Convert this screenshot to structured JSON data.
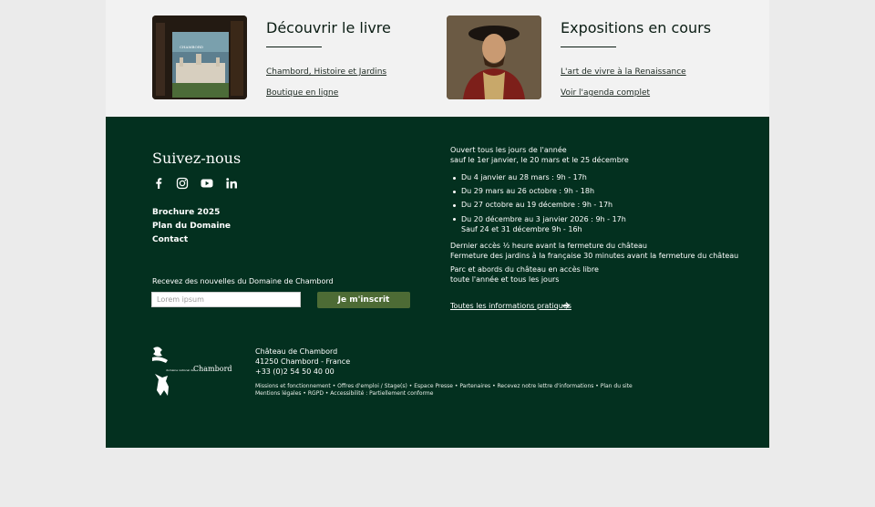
{
  "cards": [
    {
      "title": "Découvrir le livre",
      "links": [
        "Chambord, Histoire et Jardins",
        "Boutique en ligne"
      ],
      "image": "book-cover-image"
    },
    {
      "title": "Expositions en cours",
      "links": [
        "L'art de vivre à la Renaissance",
        "Voir l'agenda complet"
      ],
      "image": "portrait-francois-1er-image"
    }
  ],
  "book_cover": {
    "label": "CHAMBORD"
  },
  "footer": {
    "follow_title": "Suivez-nous",
    "social_icons": [
      "facebook-icon",
      "instagram-icon",
      "youtube-icon",
      "linkedin-icon"
    ],
    "links": [
      "Brochure 2025",
      "Plan du Domaine",
      "Contact"
    ],
    "newsletter": {
      "label": "Recevez des nouvelles du Domaine de Chambord",
      "placeholder": "Lorem ipsum",
      "button": "Je m'inscrit"
    },
    "opening": [
      "Ouvert tous les jours de l'année",
      "sauf le 1er janvier, le 20 mars et le 25 décembre"
    ],
    "hours": [
      [
        "Du 4 janvier au 28 mars : 9h - 17h"
      ],
      [
        "Du 29 mars au 26 octobre : 9h - 18h"
      ],
      [
        "Du 27 octobre au 19 décembre : 9h - 17h"
      ],
      [
        "Du 20 décembre au 3 janvier 2026 : 9h - 17h",
        "Sauf 24 et 31 décembre 9h - 16h"
      ]
    ],
    "last_access": [
      "Dernier accès ½ heure avant la fermeture du château",
      "Fermeture des jardins à la française 30 minutes avant la fermeture du château"
    ],
    "park": [
      "Parc et abords du château en accès libre",
      "toute l'année et tous les jours"
    ],
    "practical_link": "Toutes les informations pratiques",
    "logo": {
      "name": "Chambord",
      "small": "domaine national de"
    },
    "address": [
      "Château de Chambord",
      "41250 Chambord - France",
      "+33 (0)2 54 50 40 00"
    ],
    "legal_lines": [
      "Missions et fonctionnement  •  Offres d'emploi / Stage(s)  •  Espace Presse  •  Partenaires  •  Recevez notre lettre d'informations • Plan du site",
      "Mentions légales  •  RGPD  •  Accessibilité : Partiellement conforme"
    ]
  }
}
